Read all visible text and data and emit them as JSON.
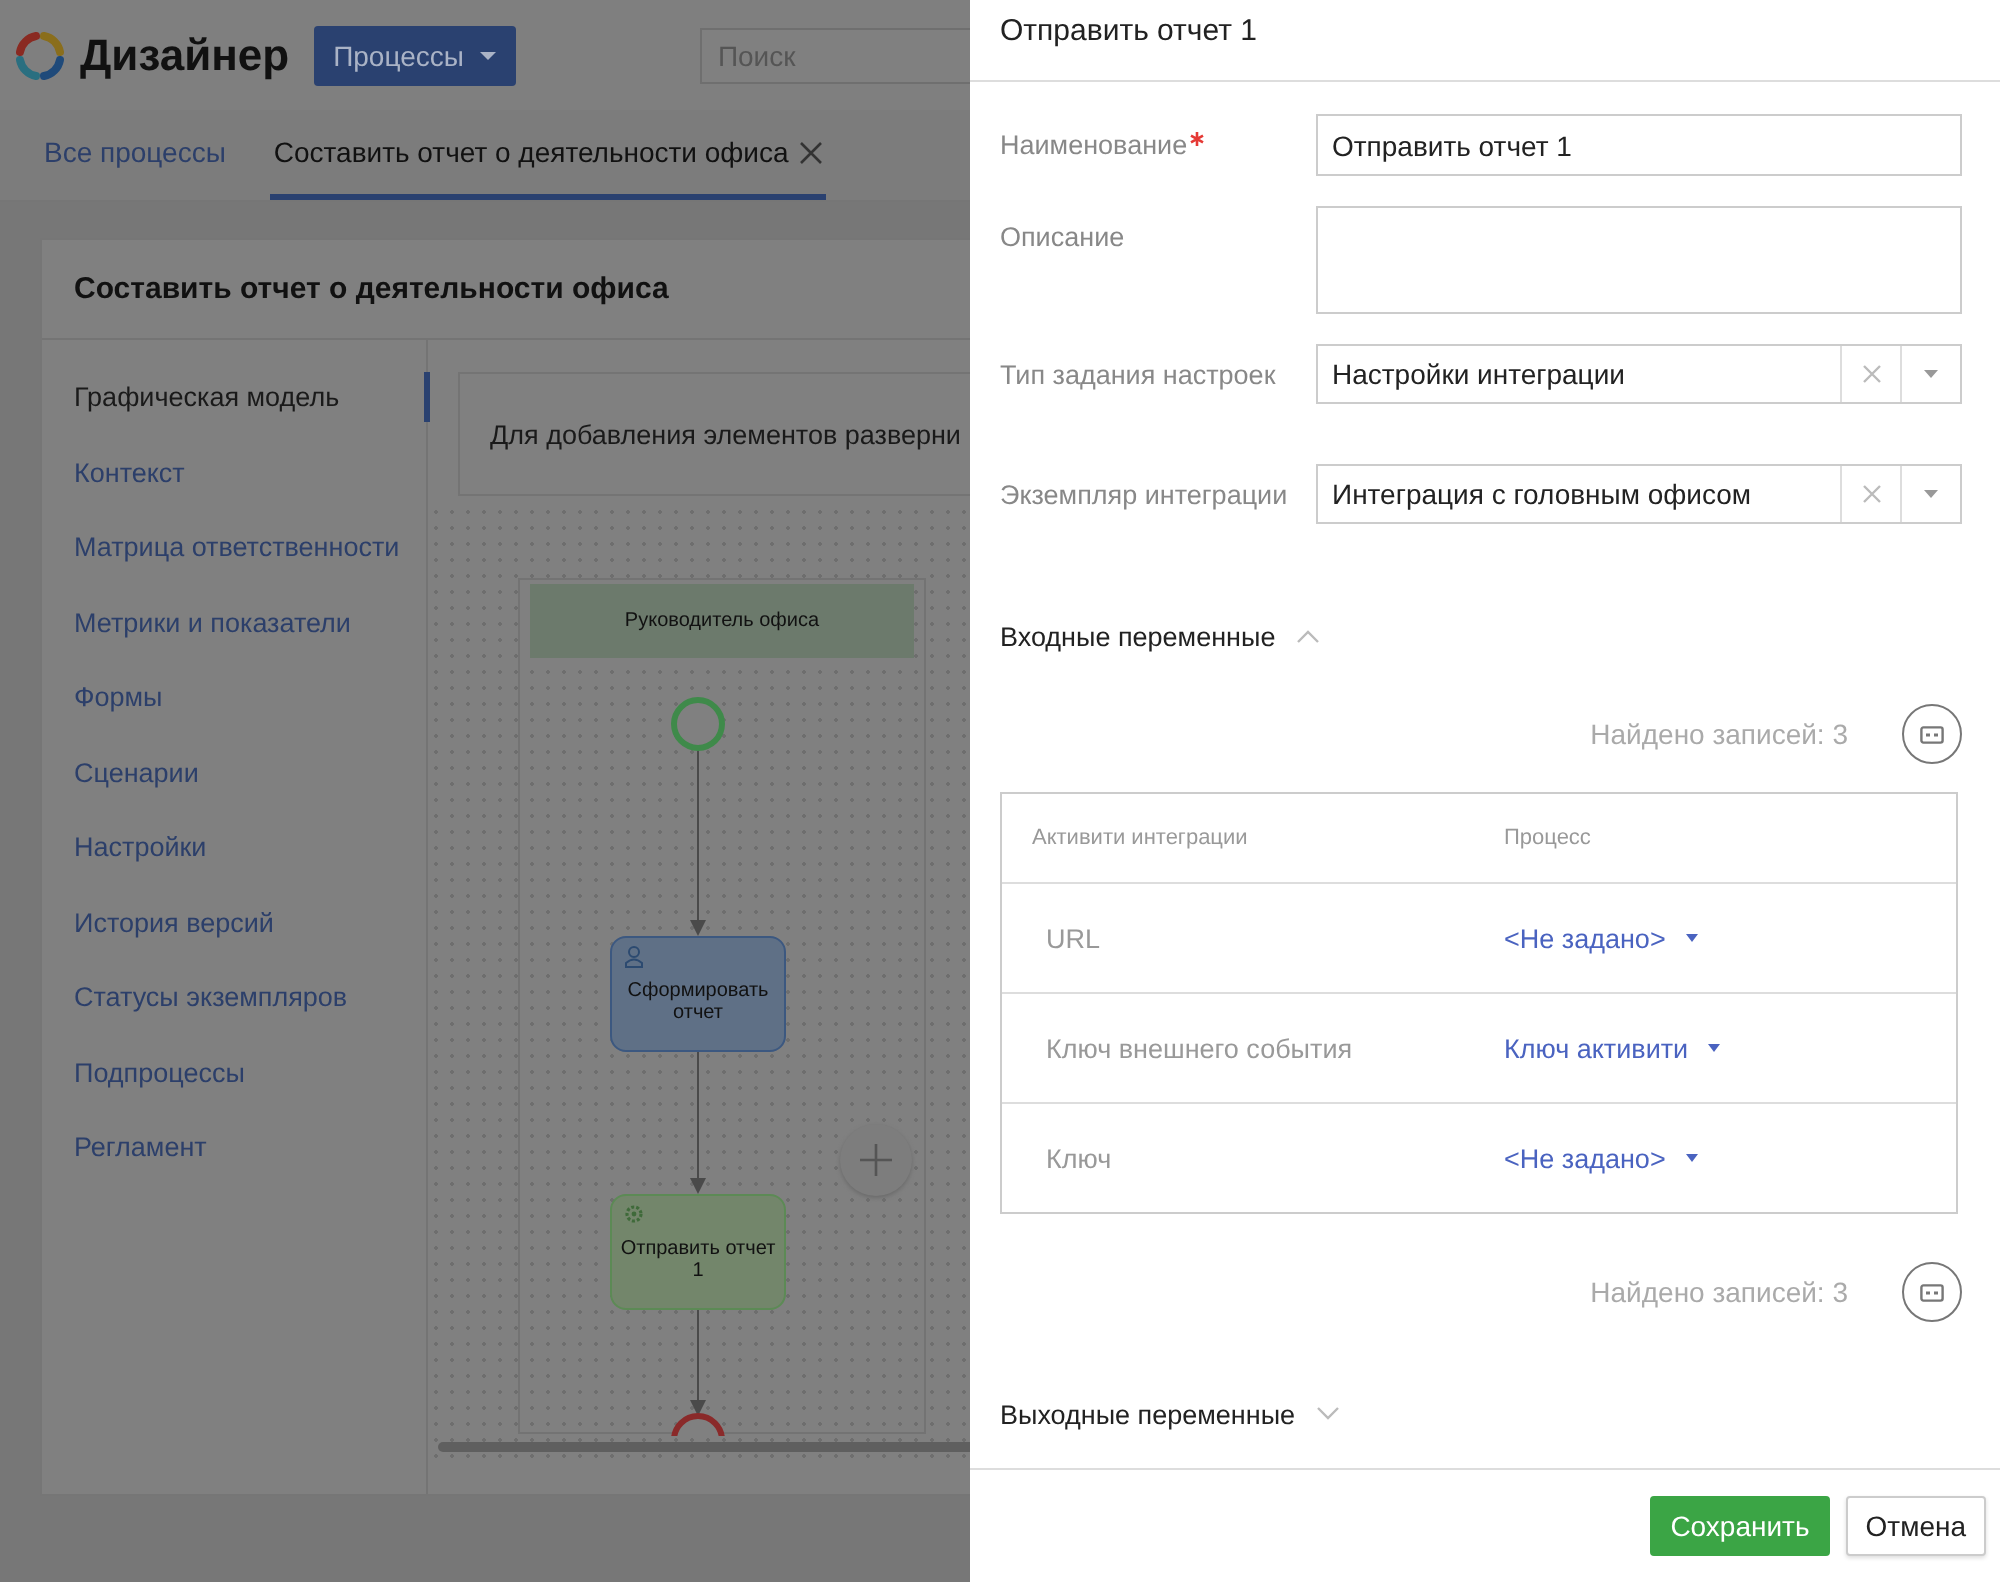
{
  "app": {
    "title": "Дизайнер",
    "menu_button": "Процессы",
    "search": {
      "placeholder": "Поиск"
    }
  },
  "tabs": [
    {
      "label": "Все процессы",
      "selected": false,
      "closable": false
    },
    {
      "label": "Составить отчет о деятельности офиса",
      "selected": true,
      "closable": true
    }
  ],
  "process": {
    "title": "Составить отчет о деятельности офиса",
    "nav": [
      {
        "label": "Графическая модель",
        "selected": true
      },
      {
        "label": "Контекст",
        "selected": false
      },
      {
        "label": "Матрица ответственности",
        "selected": false
      },
      {
        "label": "Метрики и показатели",
        "selected": false
      },
      {
        "label": "Формы",
        "selected": false
      },
      {
        "label": "Сценарии",
        "selected": false
      },
      {
        "label": "Настройки",
        "selected": false
      },
      {
        "label": "История версий",
        "selected": false
      },
      {
        "label": "Статусы экземпляров",
        "selected": false
      },
      {
        "label": "Подпроцессы",
        "selected": false
      },
      {
        "label": "Регламент",
        "selected": false
      }
    ],
    "hint": "Для добавления элементов разверни",
    "diagram": {
      "lane": "Руководитель офиса",
      "nodes": [
        {
          "kind": "start"
        },
        {
          "kind": "user_task",
          "label": "Сформировать отчет"
        },
        {
          "kind": "service_task",
          "label": "Отправить отчет 1"
        },
        {
          "kind": "end"
        }
      ]
    }
  },
  "dialog": {
    "title": "Отправить отчет 1",
    "fields": [
      {
        "kind": "text",
        "label": "Наименование",
        "required": true,
        "value": "Отправить отчет 1"
      },
      {
        "kind": "textarea",
        "label": "Описание",
        "required": false
      },
      {
        "kind": "select",
        "label": "Тип задания настроек",
        "required": false,
        "value": "Настройки интеграции"
      },
      {
        "kind": "select",
        "label": "Экземпляр интеграции",
        "required": false,
        "value": "Интеграция с головным офисом"
      }
    ],
    "input_section": {
      "label": "Входные переменные",
      "expanded": true,
      "count_top": "Найдено записей: 3",
      "count_bottom": "Найдено записей: 3",
      "columns": [
        "Активити интеграции",
        "Процесс"
      ],
      "rows": [
        {
          "name": "URL",
          "value": "<Не задано>"
        },
        {
          "name": "Ключ внешнего события",
          "value": "Ключ активити"
        },
        {
          "name": "Ключ",
          "value": "<Не задано>"
        }
      ]
    },
    "output_section": {
      "label": "Выходные переменные",
      "expanded": false
    },
    "buttons": [
      {
        "label": "Сохранить",
        "kind": "primary"
      },
      {
        "label": "Отмена",
        "kind": "secondary"
      }
    ]
  }
}
